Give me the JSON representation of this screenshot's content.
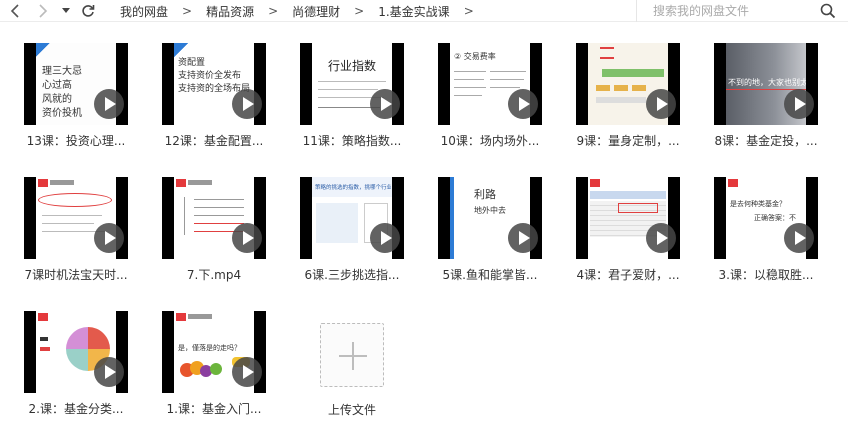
{
  "toolbar": {
    "breadcrumbs": [
      "我的网盘",
      "精品资源",
      "尚德理财",
      "1.基金实战课"
    ],
    "separator": ">",
    "search_placeholder": "搜索我的网盘文件"
  },
  "files": [
    {
      "caption": "13课：投资心理..."
    },
    {
      "caption": "12课：基金配置..."
    },
    {
      "caption": "11课：策略指数..."
    },
    {
      "caption": "10课：场内场外..."
    },
    {
      "caption": "9课：量身定制，..."
    },
    {
      "caption": "8课：基金定投，..."
    },
    {
      "caption": "7课时机法宝天时..."
    },
    {
      "caption": "7.下.mp4"
    },
    {
      "caption": "6课.三步挑选指..."
    },
    {
      "caption": "5课.鱼和能掌皆..."
    },
    {
      "caption": "4课：君子爱财，..."
    },
    {
      "caption": "3.课：以稳取胜..."
    },
    {
      "caption": "2.课：基金分类..."
    },
    {
      "caption": "1.课：基金入门..."
    }
  ],
  "thumb_text": {
    "t13": [
      "理三大忌",
      "心过高",
      "风就的",
      "资价投机"
    ],
    "t12": [
      "资配置",
      "支持资价全发布",
      "支持资的全场布局"
    ],
    "t11": {
      "title": "行业指数"
    },
    "t10": {
      "heading": "② 交易费率"
    },
    "t8": {
      "text": "不到的地，大家也别太为都"
    },
    "t6": {
      "heading": "策略的挑选的指数，挑哪个行业"
    },
    "t5": [
      "利路",
      "地外中去"
    ],
    "t3": [
      "是去何种类基金？",
      "正确答案：不"
    ],
    "t1": [
      "是，僅落是的走吗？"
    ]
  },
  "upload": {
    "label": "上传文件"
  },
  "colors": {
    "accent_blue": "#2d7bd5",
    "logo_red": "#e4393c"
  }
}
